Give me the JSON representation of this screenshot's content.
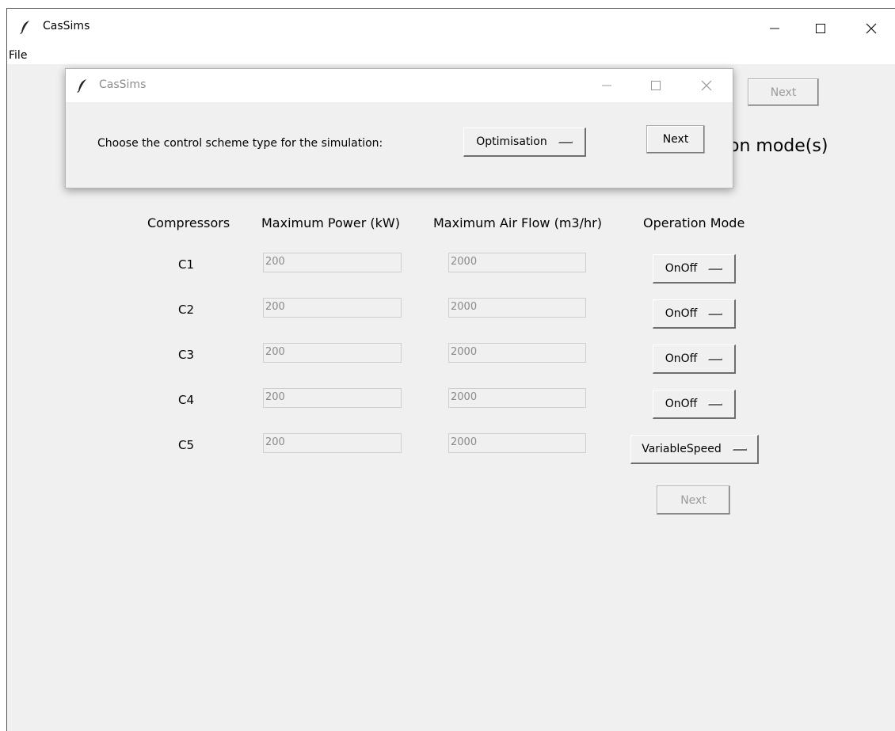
{
  "window": {
    "title": "CasSims",
    "menu": [
      "File"
    ]
  },
  "main": {
    "top_next_label": "Next",
    "heading_fragment": "on mode(s)",
    "columns": [
      "Compressors",
      "Maximum Power (kW)",
      "Maximum Air Flow (m3/hr)",
      "Operation Mode"
    ],
    "rows": [
      {
        "name": "C1",
        "power": "200",
        "airflow": "2000",
        "mode": "OnOff"
      },
      {
        "name": "C2",
        "power": "200",
        "airflow": "2000",
        "mode": "OnOff"
      },
      {
        "name": "C3",
        "power": "200",
        "airflow": "2000",
        "mode": "OnOff"
      },
      {
        "name": "C4",
        "power": "200",
        "airflow": "2000",
        "mode": "OnOff"
      },
      {
        "name": "C5",
        "power": "200",
        "airflow": "2000",
        "mode": "VariableSpeed"
      }
    ],
    "bottom_next_label": "Next"
  },
  "dialog": {
    "title": "CasSims",
    "prompt": "Choose the control scheme type for the simulation:",
    "scheme_selected": "Optimisation",
    "next_label": "Next"
  },
  "icons": {
    "app": "feather-icon",
    "minimize": "minimize-icon",
    "maximize": "maximize-icon",
    "close": "close-icon"
  }
}
